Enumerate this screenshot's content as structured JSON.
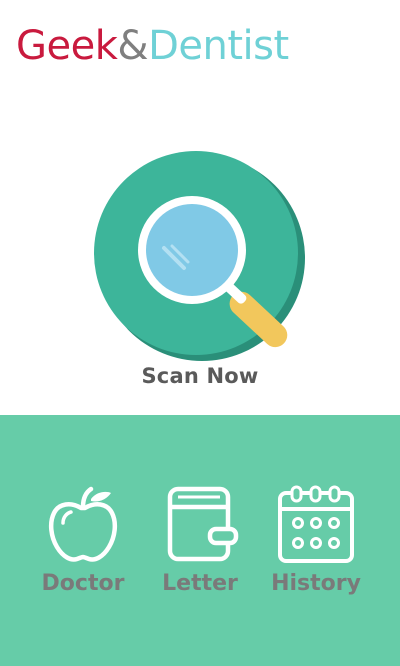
{
  "header": {
    "logo_part1": "Geek",
    "logo_amp": "&",
    "logo_part2": "Dentist"
  },
  "scan": {
    "label": "Scan Now",
    "icon": "magnifier-icon"
  },
  "nav": {
    "items": [
      {
        "label": "Doctor",
        "icon": "apple-icon"
      },
      {
        "label": "Letter",
        "icon": "wallet-icon"
      },
      {
        "label": "History",
        "icon": "calendar-icon"
      }
    ]
  },
  "colors": {
    "brand_red": "#c91a3e",
    "brand_teal": "#6fd1d6",
    "circle_teal": "#3db59a",
    "circle_shadow": "#2a8f79",
    "bottom_panel": "#66cca8",
    "handle_yellow": "#f2c75c",
    "lens_blue": "#80c9e6"
  }
}
